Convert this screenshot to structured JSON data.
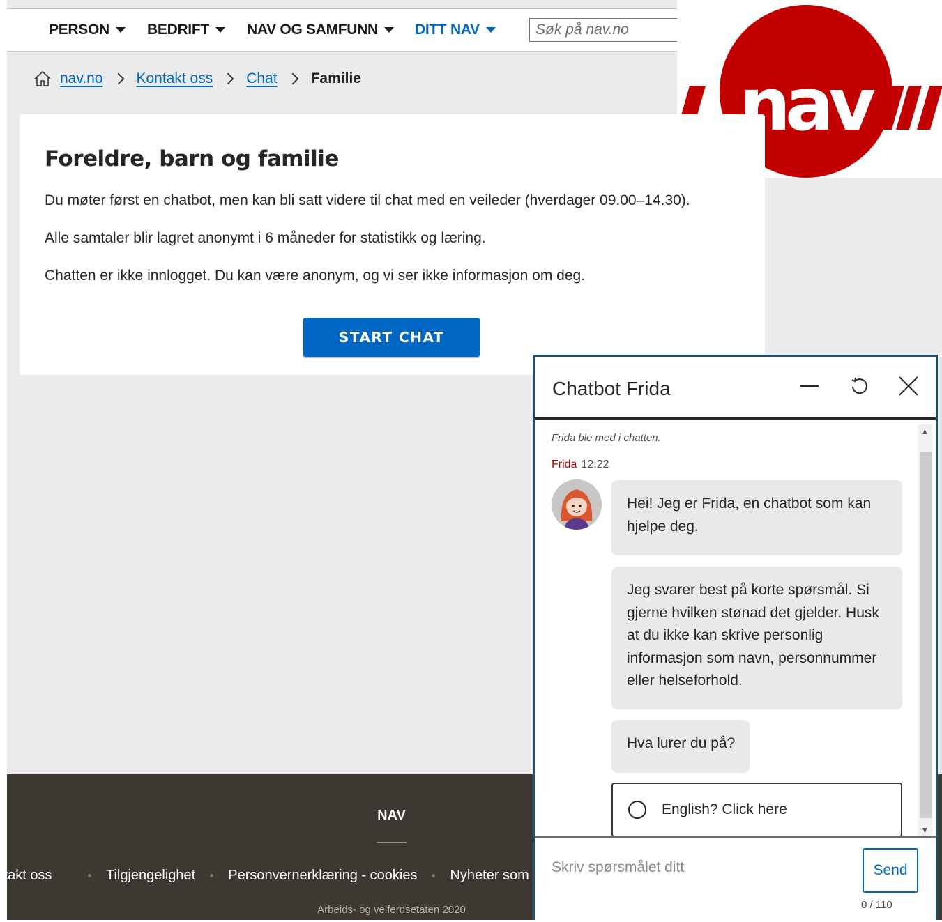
{
  "nav": {
    "items": [
      {
        "label": "PERSON"
      },
      {
        "label": "BEDRIFT"
      },
      {
        "label": "NAV OG SAMFUNN"
      },
      {
        "label": "DITT NAV"
      }
    ],
    "search_placeholder": "Søk på nav.no"
  },
  "logo": {
    "text": "nav",
    "color": "#c30000"
  },
  "breadcrumb": {
    "items": [
      "nav.no",
      "Kontakt oss",
      "Chat"
    ],
    "current": "Familie"
  },
  "card": {
    "title": "Foreldre, barn og familie",
    "paragraphs": [
      "Du møter først en chatbot, men kan bli satt videre til chat med en veileder (hverdager 09.00–14.30).",
      "Alle samtaler blir lagret anonymt i 6 måneder for statistikk og læring.",
      "Chatten er ikke innlogget. Du kan være anonym, og vi ser ikke informasjon om deg."
    ],
    "start_button": "START CHAT"
  },
  "footer": {
    "title": "NAV",
    "links": [
      "Kontakt oss",
      "Tilgjengelighet",
      "Personvernerklæring - cookies",
      "Nyheter som RSS"
    ],
    "copyright": "Arbeids- og velferdsetaten 2020"
  },
  "chat": {
    "title": "Chatbot Frida",
    "joined": "Frida ble med i chatten.",
    "sender": "Frida",
    "time": "12:22",
    "messages": [
      "Hei! Jeg er Frida, en chatbot som kan hjelpe deg.",
      "Jeg svarer best på korte spørsmål. Si gjerne hvilken stønad det gjelder. Husk at du ikke kan skrive personlig informasjon som navn, personnummer eller helseforhold.",
      "Hva lurer du på?"
    ],
    "option": "English? Click here",
    "input_placeholder": "Skriv spørsmålet ditt",
    "send": "Send",
    "counter": "0 / 110"
  },
  "colors": {
    "accent": "#0067c5",
    "brand_red": "#c30000",
    "footer_bg": "#3e3832"
  }
}
